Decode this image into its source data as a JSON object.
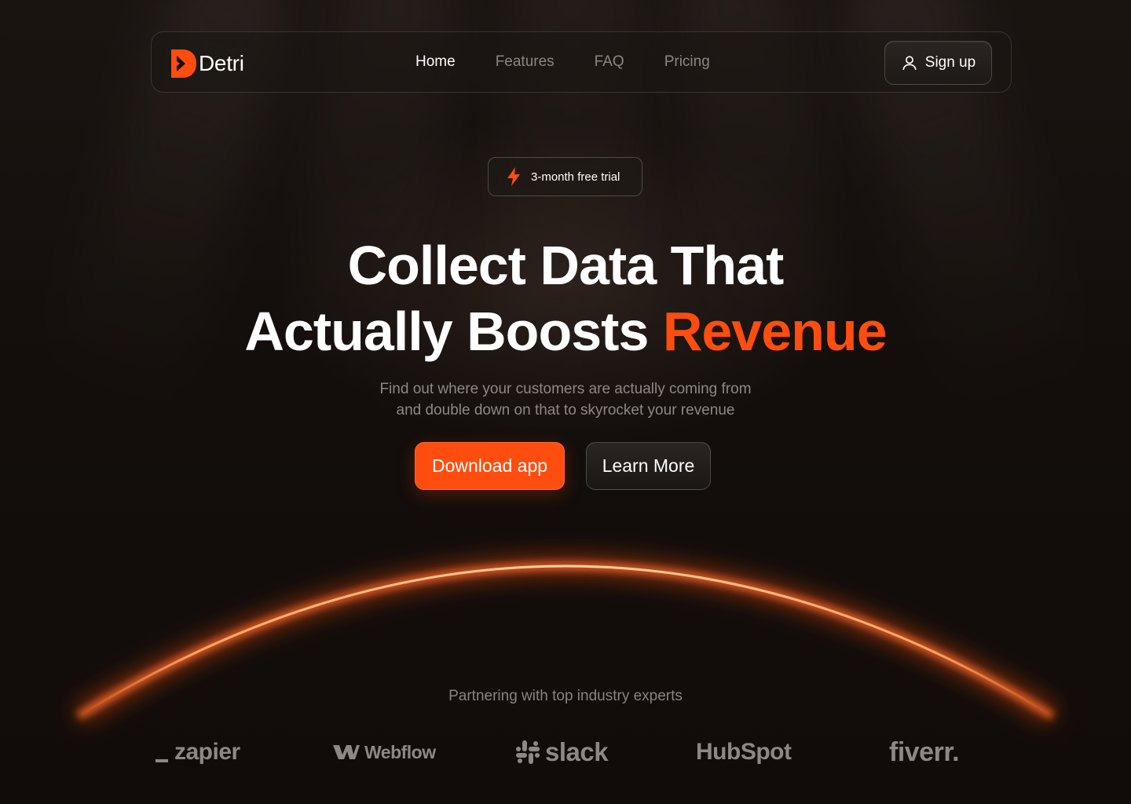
{
  "brand": {
    "name": "Detri",
    "accent": "#ff4d0f"
  },
  "nav": {
    "links": [
      {
        "label": "Home",
        "active": true
      },
      {
        "label": "Features",
        "active": false
      },
      {
        "label": "FAQ",
        "active": false
      },
      {
        "label": "Pricing",
        "active": false
      }
    ],
    "signup_label": "Sign up",
    "signup_icon": "user-icon"
  },
  "badge": {
    "icon": "lightning-icon",
    "label": "3-month free trial"
  },
  "hero": {
    "title_line1": "Collect Data That",
    "title_line2_plain": "Actually Boosts ",
    "title_line2_accent": "Revenue",
    "subtitle_line1": "Find out where your customers are actually coming from",
    "subtitle_line2": "and double down on that to skyrocket your revenue",
    "primary_cta": "Download app",
    "secondary_cta": "Learn More"
  },
  "partners": {
    "heading": "Partnering with top industry experts",
    "logos": [
      "zapier",
      "Webflow",
      "slack",
      "HubSpot",
      "fiverr."
    ]
  }
}
